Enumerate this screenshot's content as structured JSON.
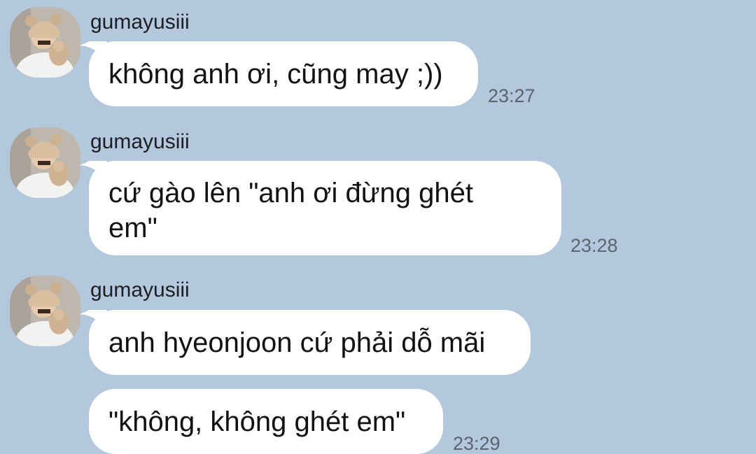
{
  "messages": [
    {
      "sender": "gumayusiii",
      "text": "không anh ơi, cũng may ;))",
      "time": "23:27"
    },
    {
      "sender": "gumayusiii",
      "text": "cứ gào lên \"anh ơi đừng ghét em\"",
      "time": "23:28"
    },
    {
      "sender": "gumayusiii",
      "text": "anh hyeonjoon cứ phải dỗ mãi",
      "time": ""
    },
    {
      "sender": "",
      "text": "\"không, không ghét em\"",
      "time": "23:29"
    }
  ],
  "colors": {
    "background": "#b3c7dd",
    "bubble": "#ffffff",
    "text": "#111214",
    "time": "#5a6570"
  }
}
